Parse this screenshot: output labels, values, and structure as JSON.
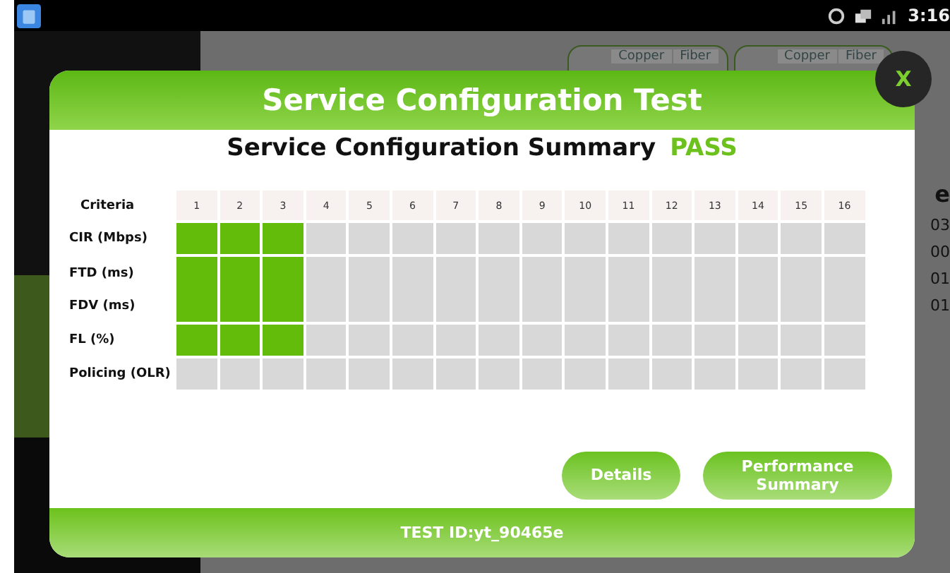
{
  "status_bar": {
    "time": "3:16"
  },
  "background": {
    "port_tabs": [
      [
        "Copper",
        "Fiber"
      ],
      [
        "Copper",
        "Fiber"
      ]
    ],
    "side_values": [
      "e",
      "03",
      "00",
      "01",
      "01"
    ]
  },
  "dialog": {
    "title": "Service Configuration Test",
    "close_label": "X",
    "summary_label": "Service Configuration Summary",
    "result": "PASS",
    "result_pass": true,
    "criteria_header": "Criteria",
    "columns": [
      "1",
      "2",
      "3",
      "4",
      "5",
      "6",
      "7",
      "8",
      "9",
      "10",
      "11",
      "12",
      "13",
      "14",
      "15",
      "16"
    ],
    "rows": [
      {
        "labels": [
          "CIR (Mbps)"
        ],
        "cells": [
          true,
          true,
          true,
          false,
          false,
          false,
          false,
          false,
          false,
          false,
          false,
          false,
          false,
          false,
          false,
          false
        ]
      },
      {
        "labels": [
          "FTD (ms)",
          "FDV (ms)"
        ],
        "cells": [
          true,
          true,
          true,
          false,
          false,
          false,
          false,
          false,
          false,
          false,
          false,
          false,
          false,
          false,
          false,
          false
        ]
      },
      {
        "labels": [
          "FL (%)"
        ],
        "cells": [
          true,
          true,
          true,
          false,
          false,
          false,
          false,
          false,
          false,
          false,
          false,
          false,
          false,
          false,
          false,
          false
        ]
      },
      {
        "labels": [
          "Policing (OLR)"
        ],
        "cells": [
          false,
          false,
          false,
          false,
          false,
          false,
          false,
          false,
          false,
          false,
          false,
          false,
          false,
          false,
          false,
          false
        ]
      }
    ],
    "buttons": [
      "Details",
      "Performance Summary"
    ],
    "footer": "TEST ID:yt_90465e"
  }
}
